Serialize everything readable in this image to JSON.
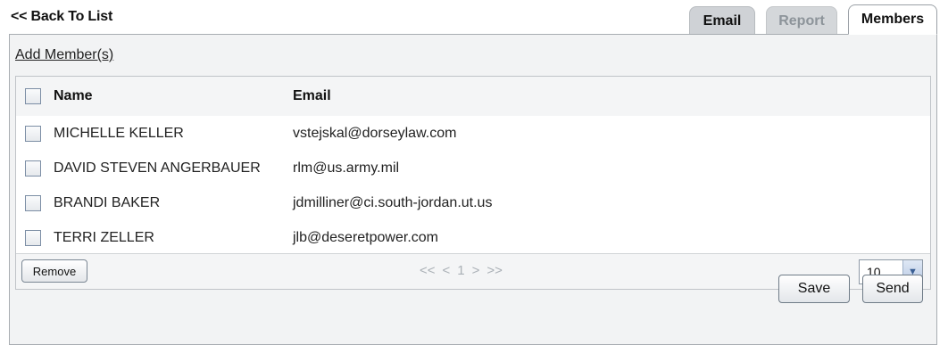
{
  "nav": {
    "back_label": "<< Back To List"
  },
  "tabs": [
    {
      "label": "Email"
    },
    {
      "label": "Report"
    },
    {
      "label": "Members"
    }
  ],
  "members": {
    "add_label": "Add Member(s)",
    "columns": {
      "name": "Name",
      "email": "Email"
    },
    "rows": [
      {
        "name": "MICHELLE KELLER",
        "email": "vstejskal@dorseylaw.com"
      },
      {
        "name": "DAVID STEVEN ANGERBAUER",
        "email": "rlm@us.army.mil"
      },
      {
        "name": "BRANDI BAKER",
        "email": "jdmilliner@ci.south-jordan.ut.us"
      },
      {
        "name": "TERRI ZELLER",
        "email": "jlb@deseretpower.com"
      }
    ],
    "remove_label": "Remove",
    "pager": {
      "first": "<<",
      "prev": "<",
      "page": "1",
      "next": ">",
      "last": ">>"
    },
    "page_size": "10"
  },
  "actions": {
    "save_label": "Save",
    "send_label": "Send"
  },
  "icons": {
    "page_size_arrow": "chevron-down-icon"
  },
  "colors": {
    "tab_active_bg": "#ffffff",
    "tab_inactive_bg": "#cfd2d6",
    "panel_bg": "#f2f3f4",
    "pager_disabled": "#aab0b6"
  }
}
